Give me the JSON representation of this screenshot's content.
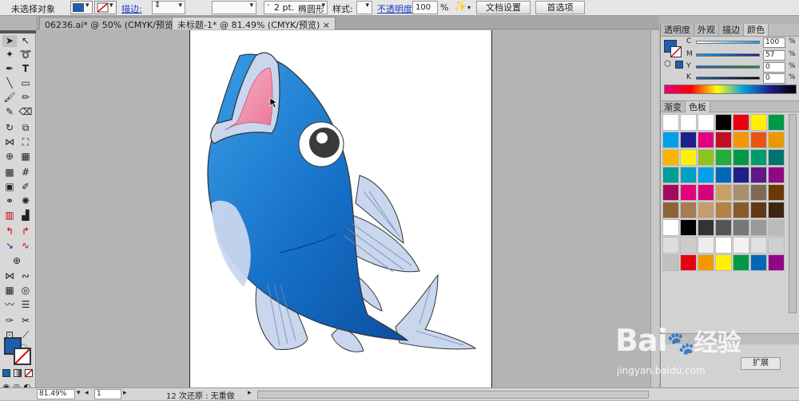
{
  "control_bar": {
    "selection_label": "未选择对象",
    "stroke_label": "描边:",
    "stroke_weight": "2 pt.",
    "brush_label": "椭圆形",
    "style_label": "样式:",
    "opacity_label": "不透明度:",
    "opacity_value": "100",
    "opacity_unit": "%",
    "doc_setup_button": "文档设置",
    "prefs_button": "首选项",
    "fill_color": "#1a5fb4"
  },
  "tabs": [
    {
      "label": "06236.ai* @ 50% (CMYK/预览)",
      "close": "×"
    },
    {
      "label": "未标题-1* @ 81.49% (CMYK/预览)",
      "close": "×"
    }
  ],
  "color_panel": {
    "tabs": [
      "透明度",
      "外观",
      "描边",
      "颜色"
    ],
    "channels": [
      {
        "name": "C",
        "value": "100"
      },
      {
        "name": "M",
        "value": "57"
      },
      {
        "name": "Y",
        "value": "0"
      },
      {
        "name": "K",
        "value": "0"
      }
    ]
  },
  "swatch_panel": {
    "tabs": [
      "渐变",
      "色板"
    ]
  },
  "bottom_panel": {
    "label": "扩展"
  },
  "status_bar": {
    "zoom": "81.49%",
    "page": "1",
    "undo_info": "12 次还原 : 无重做"
  },
  "watermark": {
    "brand": "Bai",
    "brand2": "经验",
    "url": "jingyan.baidu.com"
  }
}
